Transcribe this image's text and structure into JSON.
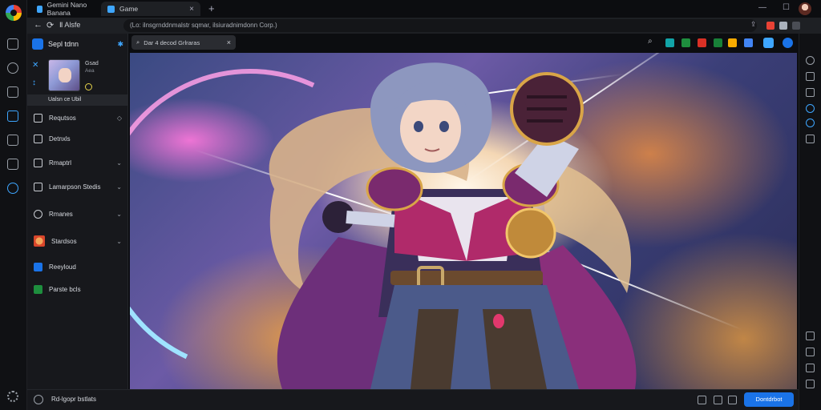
{
  "tabs": [
    {
      "label": "Gemini Nano Banana",
      "active": false
    },
    {
      "label": "Game",
      "active": true
    }
  ],
  "toolbar": {
    "address": "(Lo: ilnsgrnddnmalstr sqmar, ilsiuradnimdonn Corp.)",
    "nav_text": "Ⅱ Alsfe"
  },
  "sidebar": {
    "header_title": "Sepl tdnn",
    "profile_name": "Gsad",
    "profile_sub": "Aea",
    "selected_label": "Ualsn ce Ubil",
    "items": [
      {
        "label": "Requtsos",
        "has_chevron": false,
        "has_side_icon": true
      },
      {
        "label": "Detnxls",
        "has_chevron": false
      },
      {
        "label": "Rmaptrl",
        "has_chevron": true
      },
      {
        "label": "Lamarpson Stedis",
        "has_chevron": true
      },
      {
        "label": "Rmanes",
        "has_chevron": true
      },
      {
        "label": "Stardsos",
        "has_chevron": true
      },
      {
        "label": "Reeyloud",
        "has_chevron": false
      },
      {
        "label": "Parste bcls",
        "has_chevron": false
      }
    ]
  },
  "search_pill": {
    "text": "Dar 4 decod Grlraras"
  },
  "bottom": {
    "status_label": "Rd-lgopr bstlats",
    "cta_label": "Dontdrbot"
  },
  "colors": {
    "accent": "#1a73e8",
    "link": "#3ea6ff",
    "bg": "#0c0d10",
    "panel": "#17181c"
  },
  "icons": {
    "rail": [
      "browser-logo",
      "home-icon",
      "history-icon",
      "bookmark-icon",
      "apps-icon",
      "download-icon",
      "notes-icon",
      "compass-icon",
      "settings-icon"
    ]
  }
}
